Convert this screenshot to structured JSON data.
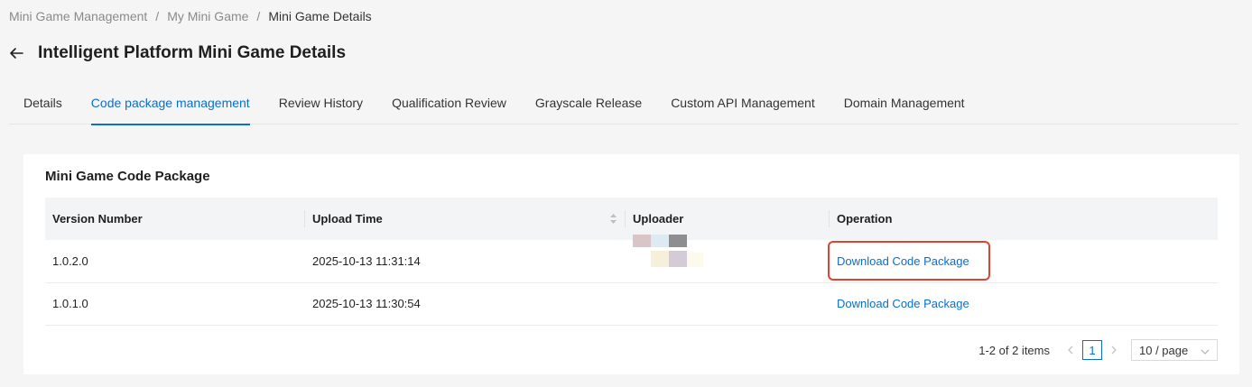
{
  "breadcrumb": {
    "items": [
      "Mini Game Management",
      "My Mini Game",
      "Mini Game Details"
    ],
    "separator": "/"
  },
  "header": {
    "title": "Intelligent Platform Mini Game Details"
  },
  "tabs": [
    {
      "label": "Details",
      "active": false
    },
    {
      "label": "Code package management",
      "active": true
    },
    {
      "label": "Review History",
      "active": false
    },
    {
      "label": "Qualification Review",
      "active": false
    },
    {
      "label": "Grayscale Release",
      "active": false
    },
    {
      "label": "Custom API Management",
      "active": false
    },
    {
      "label": "Domain Management",
      "active": false
    }
  ],
  "section": {
    "title": "Mini Game Code Package",
    "columns": [
      "Version Number",
      "Upload Time",
      "Uploader",
      "Operation"
    ],
    "rows": [
      {
        "version": "1.0.2.0",
        "upload_time": "2025-10-13 11:31:14",
        "uploader": "",
        "operation": "Download Code Package"
      },
      {
        "version": "1.0.1.0",
        "upload_time": "2025-10-13 11:30:54",
        "uploader": "",
        "operation": "Download Code Package"
      }
    ]
  },
  "pagination": {
    "total_text": "1-2 of 2 items",
    "current_page": "1",
    "page_size": "10 / page"
  },
  "colors": {
    "accent": "#0a6ed1",
    "highlight": "#e0442e"
  }
}
